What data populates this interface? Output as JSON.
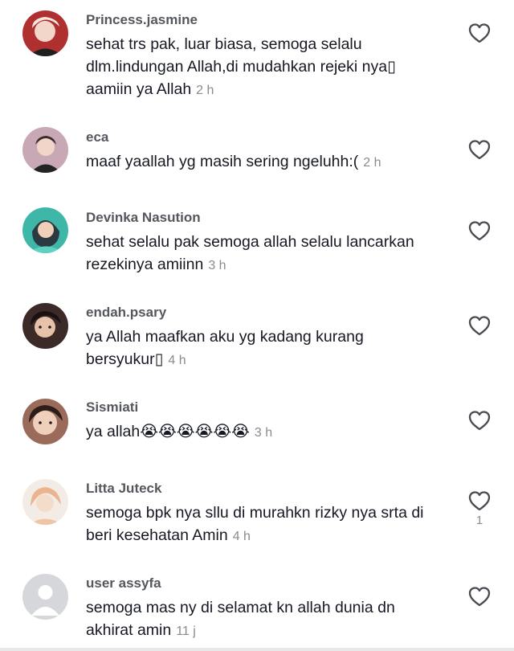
{
  "comments": [
    {
      "username": "Princess.jasmine",
      "text": "sehat trs pak, luar biasa, semoga selalu dlm.lindungan Allah,di mudahkan rejeki nya▯ aamiin ya Allah",
      "time": "2 h",
      "likes": "",
      "avatar_color": "#b03030"
    },
    {
      "username": "eca",
      "text": "maaf yaallah yg masih sering ngeluhh:(",
      "time": "2 h",
      "likes": "",
      "avatar_color": "#c9a8b6"
    },
    {
      "username": "Devinka Nasution",
      "text": "sehat selalu pak semoga allah selalu lancarkan rezekinya amiinn",
      "time": "3 h",
      "likes": "",
      "avatar_color": "#3fb7a8"
    },
    {
      "username": "endah.psary",
      "text": "ya Allah maafkan aku yg kadang kurang bersyukur▯",
      "time": "4 h",
      "likes": "",
      "avatar_color": "#3b2a28"
    },
    {
      "username": "Sismiati",
      "text": "ya allah😭😭😭😭😭😭",
      "time": "3 h",
      "likes": "",
      "avatar_color": "#9a6b5a"
    },
    {
      "username": "Litta Juteck",
      "text": "semoga bpk nya sllu di murahkn rizky nya srta di beri kesehatan Amin",
      "time": "4 h",
      "likes": "1",
      "avatar_color": "#e9b48e"
    },
    {
      "username": "user assyfa",
      "text": "semoga mas ny di selamat kn allah dunia dn akhirat amin",
      "time": "11 j",
      "likes": "",
      "avatar_color": "#d6d7da"
    }
  ],
  "icons": {
    "like": "heart-outline-icon",
    "default_avatar": "default-user-avatar-icon"
  },
  "colors": {
    "username": "#55575e",
    "text": "#161823",
    "time": "#8a8b91",
    "heart_stroke": "#4a4b52"
  }
}
